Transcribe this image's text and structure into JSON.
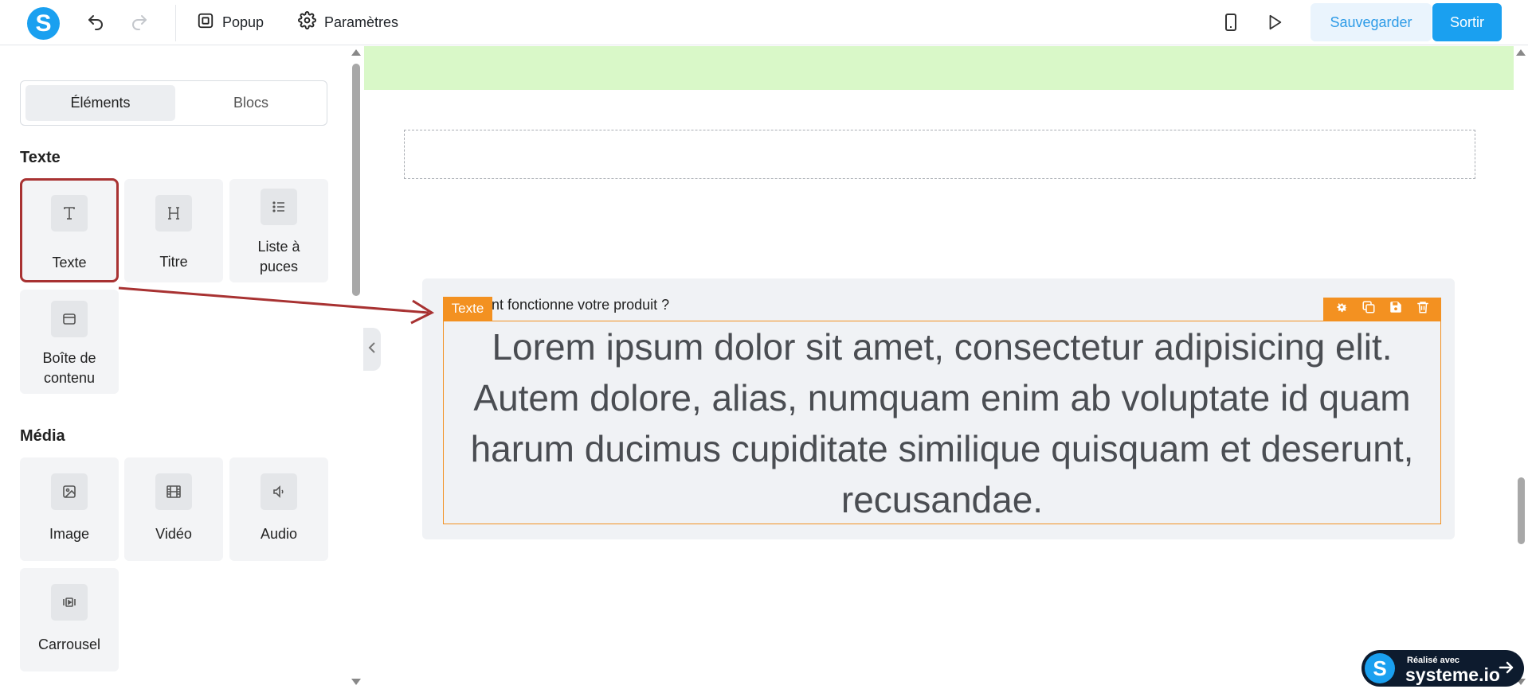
{
  "topbar": {
    "logo_letter": "S",
    "undo_icon": "undo-icon",
    "redo_icon": "redo-icon",
    "popup_label": "Popup",
    "settings_label": "Paramètres",
    "mobile_icon": "mobile-icon",
    "preview_icon": "play-icon",
    "save_label": "Sauvegarder",
    "exit_label": "Sortir"
  },
  "sidebar": {
    "tabs": [
      {
        "label": "Éléments",
        "active": true
      },
      {
        "label": "Blocs",
        "active": false
      }
    ],
    "sections": [
      {
        "title": "Texte",
        "items": [
          {
            "label": "Texte",
            "icon": "text-icon"
          },
          {
            "label": "Titre",
            "icon": "heading-icon"
          },
          {
            "label": "Liste à puces",
            "icon": "list-icon"
          },
          {
            "label": "Boîte de contenu",
            "icon": "content-box-icon"
          }
        ]
      },
      {
        "title": "Média",
        "items": [
          {
            "label": "Image",
            "icon": "image-icon"
          },
          {
            "label": "Vidéo",
            "icon": "video-icon"
          },
          {
            "label": "Audio",
            "icon": "audio-icon"
          },
          {
            "label": "Carrousel",
            "icon": "carousel-icon"
          }
        ]
      }
    ]
  },
  "canvas": {
    "element_label": "Texte",
    "subtitle": "ent fonctionne votre produit ?",
    "body_text": "Lorem ipsum dolor sit amet, consectetur adipisicing elit. Autem dolore, alias, numquam enim ab voluptate id quam harum ducimus cupiditate similique quisquam et deserunt, recusandae.",
    "toolbar_icons": [
      "gear-icon",
      "duplicate-icon",
      "save-icon",
      "trash-icon"
    ]
  },
  "badge": {
    "logo_letter": "S",
    "top_text": "Réalisé avec",
    "main_text": "systeme.io"
  },
  "colors": {
    "brand_blue": "#1aa0f0",
    "accent_orange": "#f39121",
    "highlight_red": "#a83232",
    "green_band": "#d9f8c8"
  }
}
